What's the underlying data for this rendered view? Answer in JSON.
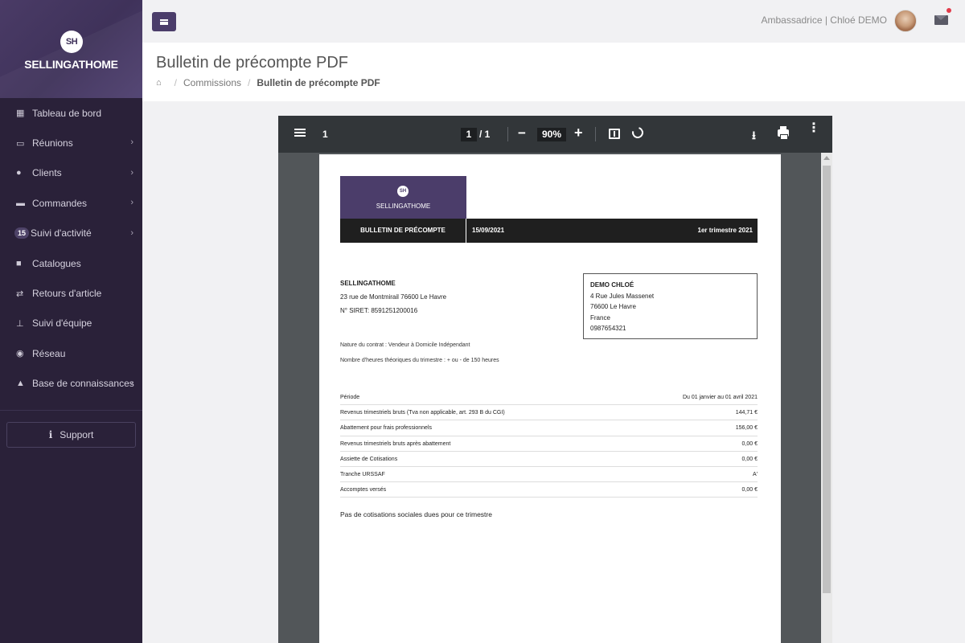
{
  "sidebar": {
    "brand_mark": "SH",
    "brand_name": "SELLINGATHOME",
    "items": [
      {
        "label": "Tableau de bord"
      },
      {
        "label": "Réunions"
      },
      {
        "label": "Clients"
      },
      {
        "label": "Commandes"
      },
      {
        "label": "Suivi d'activité",
        "count": "15"
      },
      {
        "label": "Catalogues"
      },
      {
        "label": "Retours d'article"
      },
      {
        "label": "Suivi d'équipe"
      },
      {
        "label": "Réseau"
      },
      {
        "label": "Base de connaissances"
      }
    ],
    "support_label": "Support"
  },
  "topbar": {
    "user_label": "Ambassadrice | Chloé DEMO"
  },
  "header": {
    "title": "Bulletin de précompte PDF",
    "breadcrumb": [
      "Commissions",
      "Bulletin de précompte PDF"
    ]
  },
  "pdf_viewer": {
    "toolbar": {
      "page_label": "1",
      "current_page": "1",
      "page_total": "/ 1",
      "zoom": "90%"
    },
    "document": {
      "logo_mark": "SH",
      "logo_text": "SELLINGATHOME",
      "doc_title": "BULLETIN DE PRÉCOMPTE",
      "date": "15/09/2021",
      "quarter": "1er trimestre 2021",
      "company": {
        "name": "SELLINGATHOME",
        "address": "23 rue de Montmirail 76600 Le Havre",
        "siret": "N° SIRET: 8591251200016"
      },
      "client": {
        "name": "DEMO CHLOÉ",
        "street": "4 Rue Jules Massenet",
        "city": "76600 Le Havre",
        "country": "France",
        "phone": "0987654321"
      },
      "contract": "Nature du contrat : Vendeur à Domicile Indépendant",
      "hours": "Nombre d'heures théoriques du trimestre : + ou - de 150 heures",
      "rows": [
        {
          "label": "Période",
          "value": "Du 01 janvier au 01 avril 2021"
        },
        {
          "label": "Revenus trimestriels bruts (Tva non applicable, art. 293 B du CGI)",
          "value": "144,71 €"
        },
        {
          "label": "Abattement pour frais professionnels",
          "value": "156,00 €"
        },
        {
          "label": "Revenus trimestriels bruts après abattement",
          "value": "0,00 €"
        },
        {
          "label": "Assiette de Cotisations",
          "value": "0,00 €"
        },
        {
          "label": "Tranche URSSAF",
          "value": "A'"
        },
        {
          "label": "Accomptes versés",
          "value": "0,00 €"
        }
      ],
      "note": "Pas de cotisations sociales dues pour ce trimestre"
    }
  },
  "colors": {
    "sidebar_bg": "#2a2139",
    "brand_purple": "#4b3d6a",
    "notification_dot": "#e23b4a"
  },
  "icons": [
    "dashboard-icon",
    "calendar-icon",
    "users-icon",
    "credit-card-icon",
    "book-icon",
    "exchange-icon",
    "sitemap-icon",
    "globe-icon",
    "graduation-cap-icon",
    "info-icon",
    "home-icon",
    "mail-icon",
    "menu-icon",
    "download-icon",
    "print-icon",
    "rotate-icon",
    "fit-page-icon",
    "more-icon"
  ]
}
